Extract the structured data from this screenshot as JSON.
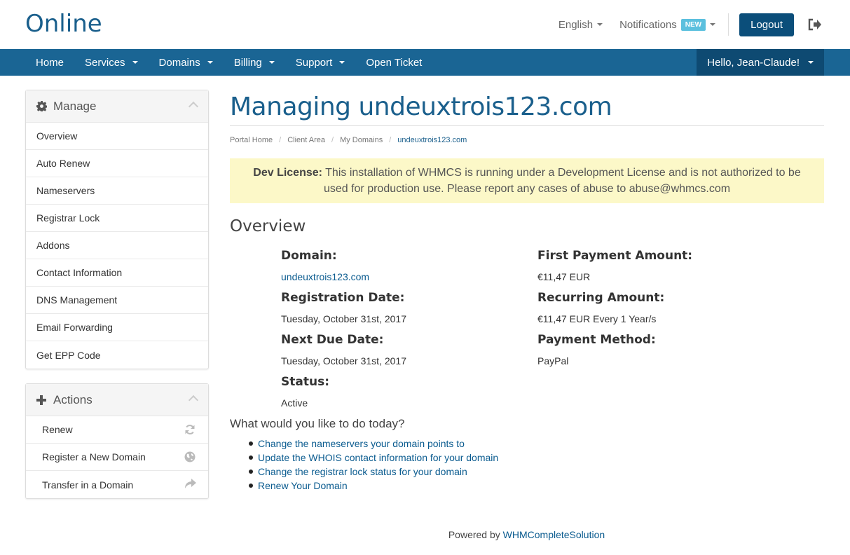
{
  "header": {
    "logo": "Online",
    "language": "English",
    "notifications": "Notifications",
    "notifications_badge": "NEW",
    "logout": "Logout"
  },
  "nav": {
    "items": [
      {
        "label": "Home",
        "dropdown": false
      },
      {
        "label": "Services",
        "dropdown": true
      },
      {
        "label": "Domains",
        "dropdown": true
      },
      {
        "label": "Billing",
        "dropdown": true
      },
      {
        "label": "Support",
        "dropdown": true
      },
      {
        "label": "Open Ticket",
        "dropdown": false
      }
    ],
    "user": "Hello, Jean-Claude!"
  },
  "sidebar": {
    "manage": {
      "title": "Manage",
      "items": [
        "Overview",
        "Auto Renew",
        "Nameservers",
        "Registrar Lock",
        "Addons",
        "Contact Information",
        "DNS Management",
        "Email Forwarding",
        "Get EPP Code"
      ]
    },
    "actions": {
      "title": "Actions",
      "items": [
        {
          "label": "Renew",
          "icon": "refresh-icon"
        },
        {
          "label": "Register a New Domain",
          "icon": "globe-icon"
        },
        {
          "label": "Transfer in a Domain",
          "icon": "share-arrow-icon"
        }
      ]
    }
  },
  "main": {
    "title": "Managing undeuxtrois123.com",
    "breadcrumb": [
      "Portal Home",
      "Client Area",
      "My Domains",
      "undeuxtrois123.com"
    ],
    "alert": {
      "label": "Dev License:",
      "text": "This installation of WHMCS is running under a Development License and is not authorized to be used for production use. Please report any cases of abuse to abuse@whmcs.com"
    },
    "overview_title": "Overview",
    "left": [
      {
        "label": "Domain:",
        "value": "undeuxtrois123.com",
        "link": true
      },
      {
        "label": "Registration Date:",
        "value": "Tuesday, October 31st, 2017"
      },
      {
        "label": "Next Due Date:",
        "value": "Tuesday, October 31st, 2017"
      },
      {
        "label": "Status:",
        "value": "Active"
      }
    ],
    "right": [
      {
        "label": "First Payment Amount:",
        "value": "€11,47 EUR"
      },
      {
        "label": "Recurring Amount:",
        "value": "€11,47 EUR Every 1 Year/s"
      },
      {
        "label": "Payment Method:",
        "value": "PayPal"
      }
    ],
    "todo_title": "What would you like to do today?",
    "todo": [
      "Change the nameservers your domain points to",
      "Update the WHOIS contact information for your domain",
      "Change the registrar lock status for your domain",
      "Renew Your Domain"
    ]
  },
  "footer": {
    "prefix": "Powered by",
    "link": "WHMCompleteSolution"
  },
  "colors": {
    "brand": "#1a5f8c",
    "navbar": "#1a6594",
    "navbar_active": "#0e4a72",
    "alert_bg": "#fcf8c8",
    "badge": "#5bc0de"
  }
}
